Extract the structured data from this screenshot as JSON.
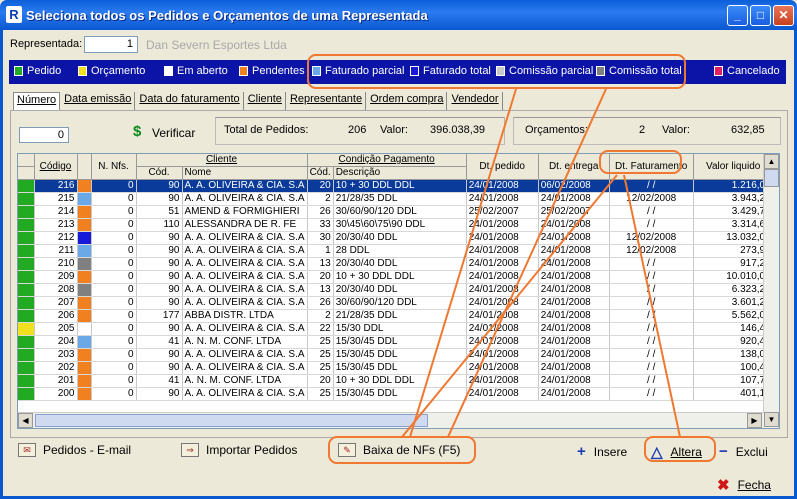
{
  "window": {
    "title": "Seleciona todos os Pedidos e Orçamentos de uma Representada",
    "app_icon": "R",
    "minimize": "_",
    "maximize": "□",
    "close": "✕"
  },
  "representada": {
    "label": "Representada:",
    "code": "1",
    "name": "Dan Severn Esportes Ltda"
  },
  "legend": [
    {
      "label": "Pedido",
      "color": "#22aa22"
    },
    {
      "label": "Orçamento",
      "color": "#f0e020"
    },
    {
      "label": "Em aberto",
      "color": "#ffffff"
    },
    {
      "label": "Pendentes",
      "color": "#f08020"
    },
    {
      "label": "Faturado parcial",
      "color": "#6aa8e8"
    },
    {
      "label": "Faturado total",
      "color": "#1818d8"
    },
    {
      "label": "Comissão parcial",
      "color": "#c8c8c8"
    },
    {
      "label": "Comissão total",
      "color": "#808080"
    },
    {
      "label": "Cancelado",
      "color": "#e02060"
    }
  ],
  "tabs": [
    "Número",
    "Data emissão",
    "Data do faturamento",
    "Cliente",
    "Representante",
    "Ordem compra",
    "Vendedor"
  ],
  "search": {
    "value": "0",
    "verify_label": "Verificar"
  },
  "totals": {
    "pedidos_label": "Total de Pedidos:",
    "pedidos_count": "206",
    "valor_label": "Valor:",
    "pedidos_valor": "396.038,39",
    "orcamentos_label": "Orçamentos:",
    "orcamentos_count": "2",
    "orcamentos_valor_label": "Valor:",
    "orcamentos_valor": "632,85"
  },
  "grid": {
    "headers": {
      "codigo": "Código",
      "nfs": "N. Nfs.",
      "cliente": "Cliente",
      "cliente_cod": "Cód.",
      "cliente_nome": "Nome",
      "cond": "Condição Pagamento",
      "cond_cod": "Cód.",
      "cond_desc": "Descrição",
      "dt_pedido": "Dt. pedido",
      "dt_entrega": "Dt. entrega",
      "dt_faturamento": "Dt. Faturamento",
      "valor": "Valor liquido"
    },
    "rows": [
      {
        "type": "#22aa22",
        "status": "#f08020",
        "codigo": "216",
        "nfs": "0",
        "cli_cod": "90",
        "cli_nome": "A. A. OLIVEIRA & CIA. S.A",
        "cond_cod": "20",
        "cond_desc": "10 + 30 DDL DDL",
        "dt_pedido": "24/01/2008",
        "dt_entrega": "06/02/2008",
        "dt_fat": "/ /",
        "valor": "1.216,00",
        "selected": true
      },
      {
        "type": "#22aa22",
        "status": "#6aa8e8",
        "codigo": "215",
        "nfs": "0",
        "cli_cod": "90",
        "cli_nome": "A. A. OLIVEIRA & CIA. S.A",
        "cond_cod": "2",
        "cond_desc": "21/28/35 DDL",
        "dt_pedido": "24/01/2008",
        "dt_entrega": "24/01/2008",
        "dt_fat": "12/02/2008",
        "valor": "3.943,20"
      },
      {
        "type": "#22aa22",
        "status": "#f08020",
        "codigo": "214",
        "nfs": "0",
        "cli_cod": "51",
        "cli_nome": "AMEND & FORMIGHIERI",
        "cond_cod": "26",
        "cond_desc": "30/60/90/120 DDL",
        "dt_pedido": "25/02/2007",
        "dt_entrega": "25/02/2007",
        "dt_fat": "/ /",
        "valor": "3.429,70"
      },
      {
        "type": "#22aa22",
        "status": "#f08020",
        "codigo": "213",
        "nfs": "0",
        "cli_cod": "110",
        "cli_nome": "ALESSANDRA DE R. FE",
        "cond_cod": "33",
        "cond_desc": "30\\45\\60\\75\\90 DDL",
        "dt_pedido": "24/01/2008",
        "dt_entrega": "24/01/2008",
        "dt_fat": "/ /",
        "valor": "3.314,62"
      },
      {
        "type": "#22aa22",
        "status": "#1818d8",
        "codigo": "212",
        "nfs": "0",
        "cli_cod": "90",
        "cli_nome": "A. A. OLIVEIRA & CIA. S.A",
        "cond_cod": "30",
        "cond_desc": "20/30/40 DDL",
        "dt_pedido": "24/01/2008",
        "dt_entrega": "24/01/2008",
        "dt_fat": "12/02/2008",
        "valor": "13.032,00"
      },
      {
        "type": "#22aa22",
        "status": "#6aa8e8",
        "codigo": "211",
        "nfs": "0",
        "cli_cod": "90",
        "cli_nome": "A. A. OLIVEIRA & CIA. S.A",
        "cond_cod": "1",
        "cond_desc": "28 DDL",
        "dt_pedido": "24/01/2008",
        "dt_entrega": "24/01/2008",
        "dt_fat": "12/02/2008",
        "valor": "273,98"
      },
      {
        "type": "#22aa22",
        "status": "#808080",
        "codigo": "210",
        "nfs": "0",
        "cli_cod": "90",
        "cli_nome": "A. A. OLIVEIRA & CIA. S.A",
        "cond_cod": "13",
        "cond_desc": "20/30/40 DDL",
        "dt_pedido": "24/01/2008",
        "dt_entrega": "24/01/2008",
        "dt_fat": "/ /",
        "valor": "917,28"
      },
      {
        "type": "#22aa22",
        "status": "#f08020",
        "codigo": "209",
        "nfs": "0",
        "cli_cod": "90",
        "cli_nome": "A. A. OLIVEIRA & CIA. S.A",
        "cond_cod": "20",
        "cond_desc": "10 + 30 DDL DDL",
        "dt_pedido": "24/01/2008",
        "dt_entrega": "24/01/2008",
        "dt_fat": "/ /",
        "valor": "10.010,00"
      },
      {
        "type": "#22aa22",
        "status": "#808080",
        "codigo": "208",
        "nfs": "0",
        "cli_cod": "90",
        "cli_nome": "A. A. OLIVEIRA & CIA. S.A",
        "cond_cod": "13",
        "cond_desc": "20/30/40 DDL",
        "dt_pedido": "24/01/2008",
        "dt_entrega": "24/01/2008",
        "dt_fat": "/ /",
        "valor": "6.323,20"
      },
      {
        "type": "#22aa22",
        "status": "#f08020",
        "codigo": "207",
        "nfs": "0",
        "cli_cod": "90",
        "cli_nome": "A. A. OLIVEIRA & CIA. S.A",
        "cond_cod": "26",
        "cond_desc": "30/60/90/120 DDL",
        "dt_pedido": "24/01/2008",
        "dt_entrega": "24/01/2008",
        "dt_fat": "/ /",
        "valor": "3.601,28"
      },
      {
        "type": "#22aa22",
        "status": "#f08020",
        "codigo": "206",
        "nfs": "0",
        "cli_cod": "177",
        "cli_nome": "ABBA DISTR. LTDA",
        "cond_cod": "2",
        "cond_desc": "21/28/35 DDL",
        "dt_pedido": "24/01/2008",
        "dt_entrega": "24/01/2008",
        "dt_fat": "/ /",
        "valor": "5.562,00"
      },
      {
        "type": "#f0e020",
        "status": "#ffffff",
        "codigo": "205",
        "nfs": "0",
        "cli_cod": "90",
        "cli_nome": "A. A. OLIVEIRA & CIA. S.A",
        "cond_cod": "22",
        "cond_desc": "15/30 DDL",
        "dt_pedido": "24/01/2008",
        "dt_entrega": "24/01/2008",
        "dt_fat": "/ /",
        "valor": "146,48"
      },
      {
        "type": "#22aa22",
        "status": "#6aa8e8",
        "codigo": "204",
        "nfs": "0",
        "cli_cod": "41",
        "cli_nome": "A. N. M. CONF. LTDA",
        "cond_cod": "25",
        "cond_desc": "15/30/45 DDL",
        "dt_pedido": "24/01/2008",
        "dt_entrega": "24/01/2008",
        "dt_fat": "/ /",
        "valor": "920,40"
      },
      {
        "type": "#22aa22",
        "status": "#f08020",
        "codigo": "203",
        "nfs": "0",
        "cli_cod": "90",
        "cli_nome": "A. A. OLIVEIRA & CIA. S.A",
        "cond_cod": "25",
        "cond_desc": "15/30/45 DDL",
        "dt_pedido": "24/01/2008",
        "dt_entrega": "24/01/2008",
        "dt_fat": "/ /",
        "valor": "138,06"
      },
      {
        "type": "#22aa22",
        "status": "#f08020",
        "codigo": "202",
        "nfs": "0",
        "cli_cod": "90",
        "cli_nome": "A. A. OLIVEIRA & CIA. S.A",
        "cond_cod": "25",
        "cond_desc": "15/30/45 DDL",
        "dt_pedido": "24/01/2008",
        "dt_entrega": "24/01/2008",
        "dt_fat": "/ /",
        "valor": "100,46"
      },
      {
        "type": "#22aa22",
        "status": "#f08020",
        "codigo": "201",
        "nfs": "0",
        "cli_cod": "41",
        "cli_nome": "A. N. M. CONF. LTDA",
        "cond_cod": "20",
        "cond_desc": "10 + 30 DDL DDL",
        "dt_pedido": "24/01/2008",
        "dt_entrega": "24/01/2008",
        "dt_fat": "/ /",
        "valor": "107,70"
      },
      {
        "type": "#22aa22",
        "status": "#f08020",
        "codigo": "200",
        "nfs": "0",
        "cli_cod": "90",
        "cli_nome": "A. A. OLIVEIRA & CIA. S.A",
        "cond_cod": "25",
        "cond_desc": "15/30/45 DDL",
        "dt_pedido": "24/01/2008",
        "dt_entrega": "24/01/2008",
        "dt_fat": "/ /",
        "valor": "401,12"
      }
    ]
  },
  "toolbar": {
    "email": "Pedidos - E-mail",
    "importar": "Importar Pedidos",
    "baixa": "Baixa de NFs (F5)",
    "insere": "Insere",
    "altera": "Altera",
    "exclui": "Exclui",
    "fecha": "Fecha"
  },
  "icons": {
    "verify": "$",
    "insere": "+",
    "altera": "△",
    "exclui": "−",
    "fecha": "✖"
  }
}
